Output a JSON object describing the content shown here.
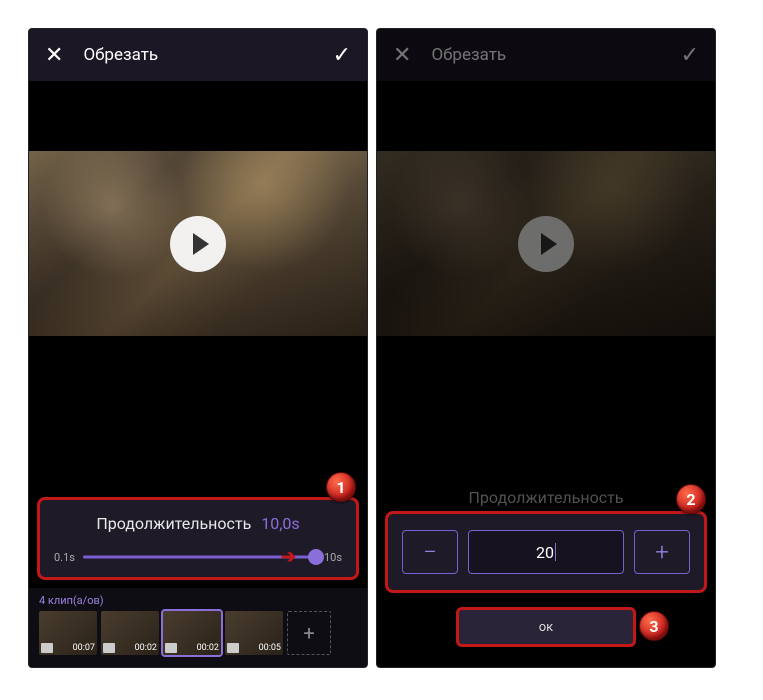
{
  "left": {
    "header": {
      "title": "Обрезать"
    },
    "duration": {
      "label": "Продолжительность",
      "value": "10,0s",
      "min": "0.1s",
      "max": "10s"
    },
    "clips": {
      "count": "4 клип(а/ов)",
      "items": [
        {
          "time": "00:07"
        },
        {
          "time": "00:02"
        },
        {
          "time": "00:02"
        },
        {
          "time": "00:05"
        }
      ]
    },
    "badge": "1"
  },
  "right": {
    "header": {
      "title": "Обрезать"
    },
    "duration_label": "Продолжительность",
    "stepper": {
      "value": "20"
    },
    "ok_label": "ок",
    "badge_stepper": "2",
    "badge_ok": "3"
  }
}
